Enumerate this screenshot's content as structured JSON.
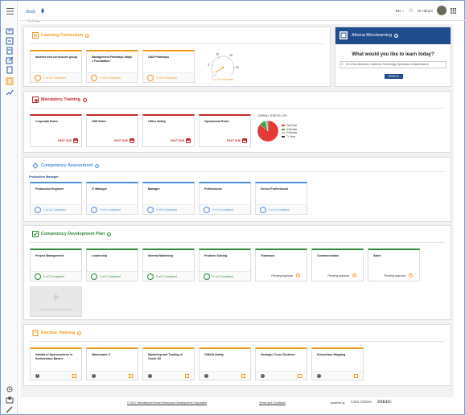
{
  "header": {
    "logo_text": "Oil & Gas",
    "language": "EN",
    "user": "Hi Harum"
  },
  "learning_curriculum": {
    "title": "Learning Curriculum",
    "cards": [
      {
        "title": "another new curriculum group",
        "progress": "1 of 10 Completed"
      },
      {
        "title": "Management Pathways Stage 1 Foundation",
        "progress": "0 of 6 Completed"
      },
      {
        "title": "O&M Pathways",
        "progress": "0 of 8 Completed"
      }
    ],
    "gauge": {
      "value": 1,
      "max": 24,
      "ticks": [
        "0",
        "5",
        "10",
        "15",
        "20"
      ],
      "caption": "1 of 24 completed"
    }
  },
  "athena": {
    "title": "Athena Microlearning",
    "question": "What would you like to learn today?",
    "search_placeholder": "Oil & Gas Business, Upstream Technology, Operations & Maintenance",
    "search_button": "SEARCH"
  },
  "mandatory": {
    "title": "Mandatory Training",
    "cards": [
      {
        "title": "Corporate Roles",
        "status": "PAST DUE"
      },
      {
        "title": "HSE Roles",
        "status": "PAST DUE"
      },
      {
        "title": "Office Safety",
        "status": "PAST DUE"
      },
      {
        "title": "Operational Roles",
        "status": "PAST DUE"
      }
    ],
    "pie": {
      "title": "OVERALL STATUS: 14%",
      "slices": [
        {
          "label": "Past Due",
          "value": 86,
          "color": "#e53935"
        },
        {
          "label": "3 Months",
          "value": 10,
          "color": "#43a047"
        },
        {
          "label": "6 Months",
          "value": 3,
          "color": "#a5d6a7"
        },
        {
          "label": "7+ Year",
          "value": 1,
          "color": "#333333"
        }
      ]
    }
  },
  "competency": {
    "title": "Competency Assessment",
    "role": "Production Manager",
    "cards": [
      {
        "title": "Production Engineer",
        "progress": "1 of 16 Completed"
      },
      {
        "title": "IT Manager",
        "progress": "0 of 6 Completed"
      },
      {
        "title": "Manager",
        "progress": "0 of 6 Completed"
      },
      {
        "title": "Professional",
        "progress": "0 of 3 Completed"
      },
      {
        "title": "Senior Professional",
        "progress": "0 of 3 Completed"
      }
    ]
  },
  "development": {
    "title": "Competency Development Plan",
    "cards": [
      {
        "title": "Project Management",
        "progress": "0 of 3 Completed",
        "type": "progress"
      },
      {
        "title": "Leadership",
        "progress": "0 of 1 Completed",
        "type": "progress"
      },
      {
        "title": "Internal Marketing",
        "progress": "0 of 1 Completed",
        "type": "progress"
      },
      {
        "title": "Problem Solving",
        "progress": "0 of 4 Completed",
        "type": "progress"
      },
      {
        "title": "Teamwork",
        "progress": "Pending Approval",
        "type": "pending"
      },
      {
        "title": "Communication",
        "progress": "Pending Approval",
        "type": "pending"
      },
      {
        "title": "Sales",
        "progress": "Pending Approval",
        "type": "pending"
      }
    ],
    "add_label": "Select New Competency Unit"
  },
  "elective": {
    "title": "Elective Training",
    "cards": [
      {
        "title": "Habitat of Hydrocarbons in Sedimentary Basins"
      },
      {
        "title": "Wastewater 3"
      },
      {
        "title": "Marketing and Trading of Crude Oil"
      },
      {
        "title": "Oilfield Safety"
      },
      {
        "title": "Geologic Cross Sections"
      },
      {
        "title": "Subsurface Mapping"
      }
    ]
  },
  "footer": {
    "copyright": "© 2021 International Human Resources Development Corporation",
    "terms": "Terms and Conditions",
    "powered": "powered by",
    "brand1": "CMS Online",
    "brand2": "IHRDC"
  },
  "colors": {
    "orange": "#f29a1f",
    "red": "#c62828",
    "blue": "#4a90d9",
    "green": "#2e8b3a",
    "navy": "#2b5ca8"
  }
}
